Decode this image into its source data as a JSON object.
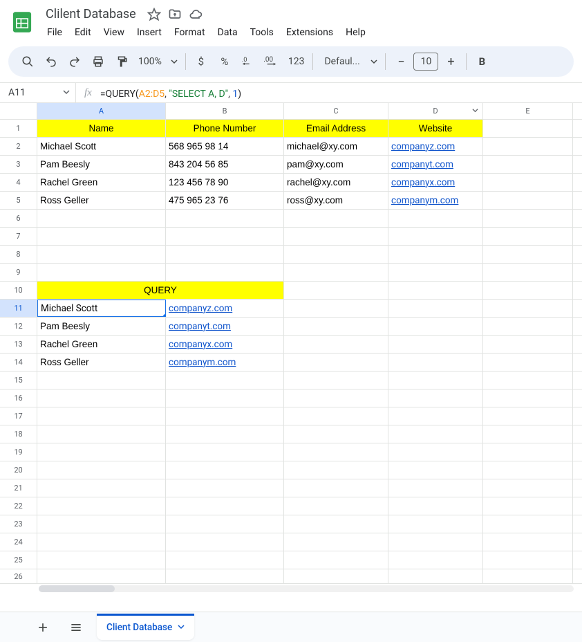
{
  "doc": {
    "title": "Clilent Database"
  },
  "menu": {
    "file": "File",
    "edit": "Edit",
    "view": "View",
    "insert": "Insert",
    "format": "Format",
    "data": "Data",
    "tools": "Tools",
    "extensions": "Extensions",
    "help": "Help"
  },
  "toolbar": {
    "zoom": "100%",
    "font_name": "Defaul...",
    "font_size": "10",
    "currency": "$",
    "percent": "%",
    "numfmt": "123"
  },
  "namebox": {
    "ref": "A11"
  },
  "formula": {
    "eq": "=",
    "fn_open": "QUERY(",
    "range": "A2:D5",
    "sep1": ", ",
    "str": "\"SELECT A, D\"",
    "sep2": ", ",
    "num": "1",
    "close": ")"
  },
  "columns": {
    "a": "A",
    "b": "B",
    "c": "C",
    "d": "D",
    "e": "E"
  },
  "headers": {
    "name": "Name",
    "phone": "Phone Number",
    "email": "Email Address",
    "website": "Website"
  },
  "rows": [
    {
      "name": "Michael Scott",
      "phone": "568 965 98 14",
      "email": "michael@xy.com",
      "website": "companyz.com"
    },
    {
      "name": "Pam Beesly",
      "phone": "843 204 56 85",
      "email": "pam@xy.com",
      "website": "companyt.com"
    },
    {
      "name": "Rachel Green",
      "phone": "123 456 78 90",
      "email": "rachel@xy.com",
      "website": "companyx.com"
    },
    {
      "name": "Ross Geller",
      "phone": "475 965 23 76",
      "email": "ross@xy.com",
      "website": "companym.com"
    }
  ],
  "query_header": "QUERY",
  "query_rows": [
    {
      "name": "Michael Scott",
      "website": "companyz.com"
    },
    {
      "name": "Pam Beesly",
      "website": "companyt.com"
    },
    {
      "name": "Rachel Green",
      "website": "companyx.com"
    },
    {
      "name": "Ross Geller",
      "website": "companym.com"
    }
  ],
  "row_nums": [
    "1",
    "2",
    "3",
    "4",
    "5",
    "6",
    "7",
    "8",
    "9",
    "10",
    "11",
    "12",
    "13",
    "14",
    "15",
    "16",
    "17",
    "18",
    "19",
    "20",
    "21",
    "22",
    "23",
    "24",
    "25",
    "26"
  ],
  "tabs": {
    "sheet1": "Client Database"
  }
}
